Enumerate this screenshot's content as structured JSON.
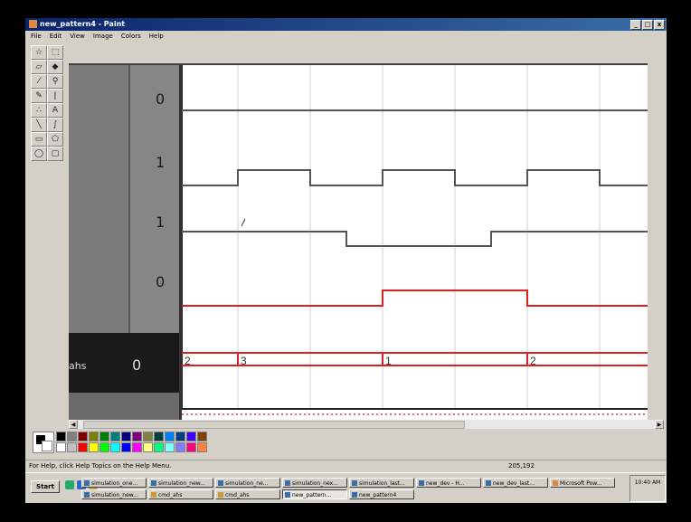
{
  "window": {
    "title": "new_pattern4 - Paint"
  },
  "menu": [
    "File",
    "Edit",
    "View",
    "Image",
    "Colors",
    "Help"
  ],
  "window_buttons": [
    "_",
    "□",
    "x"
  ],
  "signals": [
    {
      "value": "0",
      "color": "#555555"
    },
    {
      "value": "1",
      "color": "#555555"
    },
    {
      "value": "1",
      "color": "#555555"
    },
    {
      "value": "0",
      "color": "#e02020"
    }
  ],
  "bus": {
    "name": "ahs",
    "value": "0",
    "segments": [
      "2",
      "3",
      "1",
      "2"
    ],
    "color": "#e02020"
  },
  "statusbar": {
    "help": "For Help, click Help Topics on the Help Menu.",
    "coords": "205,192"
  },
  "taskbar": {
    "start": "Start",
    "tasks_row1": [
      "simulation_one...",
      "simulation_new...",
      "simulation_ne...",
      "simulation_nex...",
      "simulation_last...",
      "new_dev - H...",
      "new_dev_last...",
      "Microsoft Pow..."
    ],
    "tasks_row2": [
      "simulation_new...",
      "cmd_ahs",
      "cmd_ahs",
      "new_pattern...",
      "new_pattern4"
    ],
    "clock": "10:40 AM"
  },
  "colors": {
    "palette_row1": [
      "#000000",
      "#808080",
      "#800000",
      "#808000",
      "#008000",
      "#008080",
      "#000080",
      "#800080",
      "#808040",
      "#004040",
      "#0080ff",
      "#004080",
      "#4000ff",
      "#804000"
    ],
    "palette_row2": [
      "#ffffff",
      "#c0c0c0",
      "#ff0000",
      "#ffff00",
      "#00ff00",
      "#00ffff",
      "#0000ff",
      "#ff00ff",
      "#ffff80",
      "#00ff80",
      "#80ffff",
      "#8080ff",
      "#ff0080",
      "#ff8040"
    ],
    "foreground": "#000000",
    "background": "#ffffff"
  }
}
